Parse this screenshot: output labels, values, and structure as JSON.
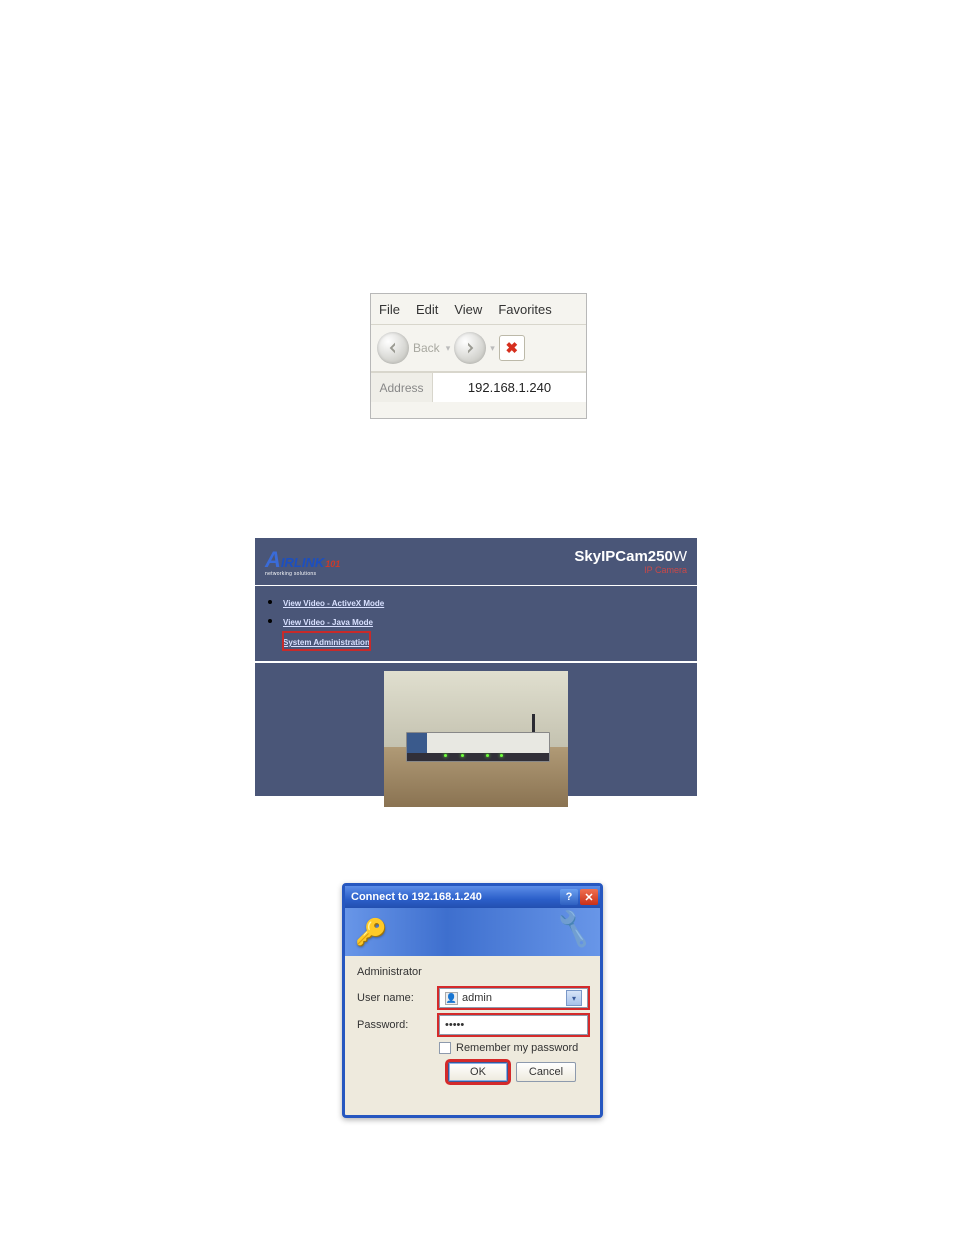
{
  "browser": {
    "menu": {
      "file": "File",
      "edit": "Edit",
      "view": "View",
      "favorites": "Favorites"
    },
    "back_label": "Back",
    "address_label": "Address",
    "address_value": "192.168.1.240"
  },
  "camera_page": {
    "product_name": "SkyIPCam250",
    "product_suffix": "W",
    "subtitle": "IP Camera",
    "logo_text": "IRLINK",
    "logo_num": "101",
    "logo_tagline": "networking solutions",
    "links": {
      "activex": "View Video - ActiveX Mode",
      "java": "View Video - Java Mode",
      "admin": "System Administration"
    }
  },
  "auth_dialog": {
    "title": "Connect to 192.168.1.240",
    "realm": "Administrator",
    "username_label": "User name:",
    "password_label": "Password:",
    "username_value": "admin",
    "password_masked": "•••••",
    "remember_label": "Remember my password",
    "ok_label": "OK",
    "cancel_label": "Cancel"
  }
}
